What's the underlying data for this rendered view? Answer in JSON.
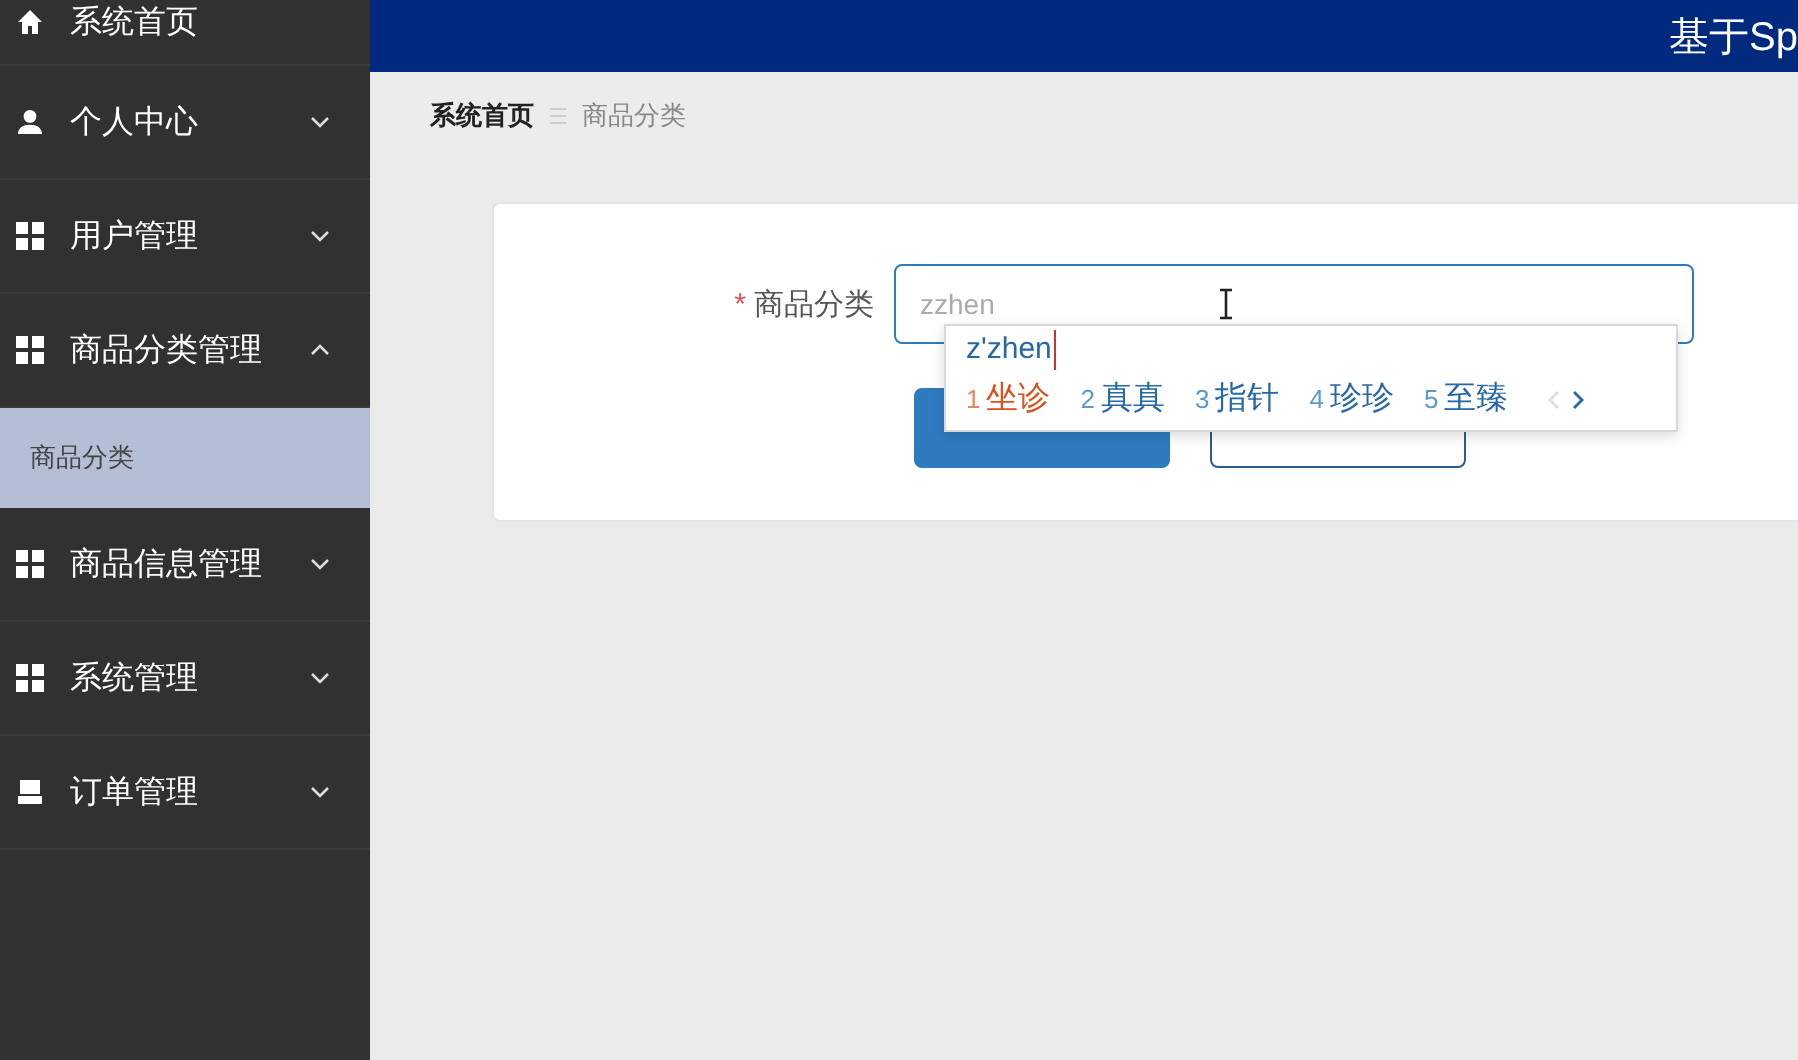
{
  "header": {
    "title": "基于Sp"
  },
  "sidebar": {
    "items": [
      {
        "kind": "home",
        "label": "系统首页"
      },
      {
        "kind": "user",
        "label": "个人中心",
        "expanded": false
      },
      {
        "kind": "grid",
        "label": "用户管理",
        "expanded": false
      },
      {
        "kind": "grid",
        "label": "商品分类管理",
        "expanded": true,
        "children": [
          {
            "label": "商品分类",
            "selected": true
          }
        ]
      },
      {
        "kind": "grid",
        "label": "商品信息管理",
        "expanded": false
      },
      {
        "kind": "grid",
        "label": "系统管理",
        "expanded": false
      },
      {
        "kind": "order",
        "label": "订单管理",
        "expanded": false
      }
    ]
  },
  "breadcrumb": [
    {
      "label": "系统首页",
      "current": false
    },
    {
      "label": "商品分类",
      "current": true
    }
  ],
  "form": {
    "fields": [
      {
        "label": "商品分类",
        "required_mark": "*",
        "value": "zzhen"
      }
    ],
    "buttons": [
      {
        "kind": "primary"
      },
      {
        "kind": "default"
      }
    ]
  },
  "ime_popup": {
    "composition": "z'zhen",
    "candidates": [
      {
        "index": "1",
        "text": "坐诊",
        "selected": true
      },
      {
        "index": "2",
        "text": "真真",
        "selected": false
      },
      {
        "index": "3",
        "text": "指针",
        "selected": false
      },
      {
        "index": "4",
        "text": "珍珍",
        "selected": false
      },
      {
        "index": "5",
        "text": "至臻",
        "selected": false
      }
    ],
    "prev_enabled": false,
    "next_enabled": true
  }
}
